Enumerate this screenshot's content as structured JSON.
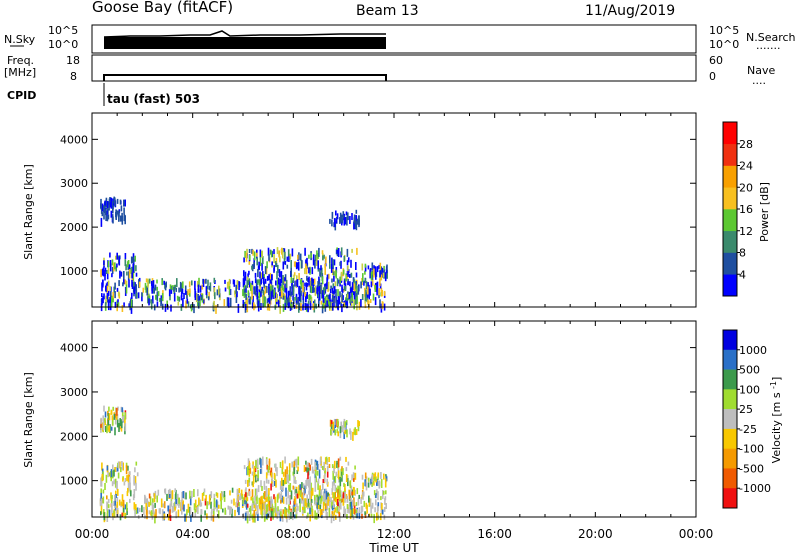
{
  "header": {
    "station": "Goose Bay (fitACF)",
    "beam": "Beam 13",
    "date": "11/Aug/2019"
  },
  "strip1": {
    "left_label": "N.Sky",
    "left_ticks": [
      "10^5",
      "10^0"
    ],
    "right_ticks": [
      "10^5",
      "10^0"
    ],
    "right_label": "N.Search",
    "right_dots": "......."
  },
  "strip2": {
    "left_label_1": "Freq.",
    "left_label_2": "[MHz]",
    "left_ticks": [
      "18",
      "8"
    ],
    "right_ticks": [
      "60",
      "0"
    ],
    "right_label": "Nave",
    "right_dots": "...."
  },
  "cpid": {
    "label": "CPID",
    "text": "tau (fast) 503"
  },
  "colors": {
    "power": [
      "#0000ff",
      "#1f4fa0",
      "#3a8a6c",
      "#5cc832",
      "#c8d040",
      "#f8c020",
      "#f8a000",
      "#f06800",
      "#f03010",
      "#ff0000"
    ],
    "velocity": [
      "#f01010",
      "#f05a00",
      "#f59a00",
      "#f8c800",
      "#bebebe",
      "#bebebe",
      "#a0dc30",
      "#3c9a4c",
      "#2a70c8",
      "#0000e0"
    ]
  },
  "chart_data": [
    {
      "type": "heatmap",
      "title": "Power",
      "xlabel": "Time UT",
      "ylabel": "Slant Range [km]",
      "colorbar_label": "Power [dB]",
      "colorbar_ticks": [
        "4",
        "8",
        "12",
        "16",
        "20",
        "24",
        "28"
      ],
      "x_ticks": [
        "00:00",
        "04:00",
        "08:00",
        "12:00",
        "16:00",
        "20:00",
        "00:00"
      ],
      "xlim": [
        0,
        24
      ],
      "y_ticks": [
        "1000",
        "2000",
        "3000",
        "4000"
      ],
      "ylim": [
        180,
        4600
      ],
      "regions": [
        {
          "t": [
            0.3,
            1.3
          ],
          "r": [
            2150,
            2650
          ]
        },
        {
          "t": [
            0.3,
            1.8
          ],
          "r": [
            900,
            1400
          ]
        },
        {
          "t": [
            0.3,
            11.7
          ],
          "r": [
            180,
            800
          ]
        },
        {
          "t": [
            6.0,
            10.5
          ],
          "r": [
            180,
            1500
          ]
        },
        {
          "t": [
            9.4,
            10.6
          ],
          "r": [
            2050,
            2350
          ]
        },
        {
          "t": [
            10.7,
            11.7
          ],
          "r": [
            900,
            1150
          ]
        }
      ]
    },
    {
      "type": "heatmap",
      "title": "Velocity",
      "xlabel": "Time UT",
      "ylabel": "Slant Range [km]",
      "colorbar_label": "Velocity [m s^-1]",
      "colorbar_ticks": [
        "1000",
        "500",
        "100",
        "25",
        "-25",
        "-100",
        "-500",
        "-1000"
      ],
      "x_ticks": [
        "00:00",
        "04:00",
        "08:00",
        "12:00",
        "16:00",
        "20:00",
        "00:00"
      ],
      "xlim": [
        0,
        24
      ],
      "y_ticks": [
        "1000",
        "2000",
        "3000",
        "4000"
      ],
      "ylim": [
        180,
        4600
      ],
      "regions": [
        {
          "t": [
            0.3,
            1.3
          ],
          "r": [
            2150,
            2650
          ]
        },
        {
          "t": [
            0.3,
            1.8
          ],
          "r": [
            900,
            1400
          ]
        },
        {
          "t": [
            0.3,
            11.7
          ],
          "r": [
            180,
            800
          ]
        },
        {
          "t": [
            6.0,
            10.5
          ],
          "r": [
            180,
            1500
          ]
        },
        {
          "t": [
            9.4,
            10.6
          ],
          "r": [
            2050,
            2350
          ]
        },
        {
          "t": [
            10.7,
            11.7
          ],
          "r": [
            900,
            1150
          ]
        }
      ]
    }
  ],
  "time_axis_label": "Time UT"
}
